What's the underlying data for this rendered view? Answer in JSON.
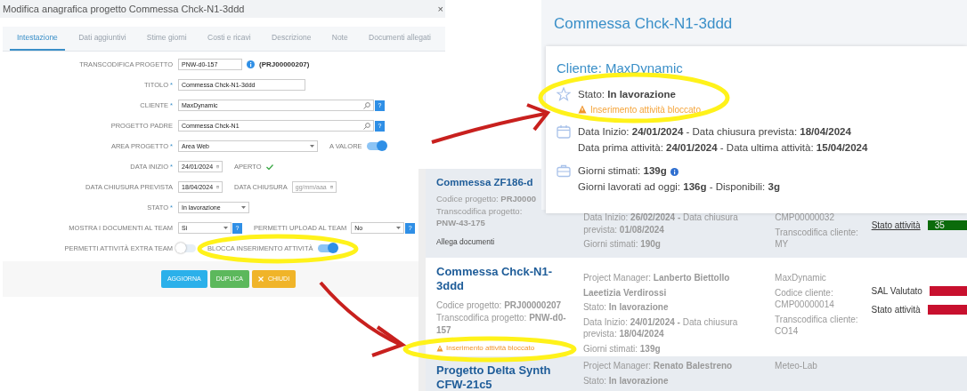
{
  "dialog": {
    "title": "Modifica anagrafica progetto Commessa Chck-N1-3ddd",
    "close": "×",
    "tabs": [
      {
        "label": "Intestazione",
        "selected": true
      },
      {
        "label": "Dati aggiuntivi",
        "selected": false
      },
      {
        "label": "Stime giorni",
        "selected": false
      },
      {
        "label": "Costi e ricavi",
        "selected": false
      },
      {
        "label": "Descrizione",
        "selected": false
      },
      {
        "label": "Note",
        "selected": false
      },
      {
        "label": "Documenti allegati",
        "selected": false
      }
    ],
    "rows": [
      {
        "label": "TRANSCODIFICA PROGETTO",
        "controls": [
          {
            "kind": "code",
            "value": "PNW-d0-157"
          },
          {
            "kind": "info"
          },
          {
            "kind": "note",
            "text": "(PRJ00000207)"
          }
        ]
      },
      {
        "label": "TITOLO",
        "marker": "*",
        "controls": [
          {
            "kind": "text",
            "value": "Commessa Chck-N1-3ddd"
          }
        ]
      },
      {
        "label": "CLIENTE",
        "marker": "*",
        "controls": [
          {
            "kind": "lookup",
            "value": "MaxDynamic"
          },
          {
            "kind": "help",
            "text": "?"
          }
        ]
      },
      {
        "label": "PROGETTO PADRE",
        "controls": [
          {
            "kind": "lookup",
            "value": "Commessa Chck-N1"
          },
          {
            "kind": "help",
            "text": "?"
          }
        ]
      },
      {
        "label": "AREA PROGETTO",
        "marker": "*",
        "controls": [
          {
            "kind": "combo",
            "value": "Area Web"
          },
          {
            "kind": "caption",
            "text": "A VALORE"
          },
          {
            "kind": "toggle",
            "on": true
          }
        ]
      },
      {
        "label": "DATA INIZIO",
        "marker": "*",
        "controls": [
          {
            "kind": "date",
            "value": "24/01/2024"
          },
          {
            "kind": "caption",
            "text": "APERTO"
          },
          {
            "kind": "check"
          }
        ]
      },
      {
        "label": "DATA CHIUSURA PREVISTA",
        "controls": [
          {
            "kind": "date",
            "value": "18/04/2024"
          },
          {
            "kind": "caption",
            "text": "DATA CHIUSURA"
          },
          {
            "kind": "date",
            "placeholder": "gg/mm/aaa"
          }
        ]
      },
      {
        "label": "STATO",
        "marker": "*",
        "controls": [
          {
            "kind": "select",
            "value": "In lavorazione"
          }
        ]
      },
      {
        "label": "MOSTRA I DOCUMENTI AL TEAM",
        "controls": [
          {
            "kind": "picker",
            "value": "Si"
          },
          {
            "kind": "help",
            "text": "?"
          },
          {
            "kind": "caption",
            "text": "PERMETTI UPLOAD AL TEAM"
          },
          {
            "kind": "picker",
            "value": "No"
          },
          {
            "kind": "help",
            "text": "?"
          }
        ]
      },
      {
        "label": "PERMETTI ATTIVITÀ EXTRA TEAM",
        "controls": [
          {
            "kind": "toggle",
            "on": false
          },
          {
            "kind": "caption",
            "text": "BLOCCA INSERIMENTO ATTIVITÀ"
          },
          {
            "kind": "toggle",
            "on": true
          }
        ]
      }
    ],
    "buttons": [
      {
        "label": "AGGIORNA"
      },
      {
        "label": "DUPLICA"
      },
      {
        "label": "CHIUDI",
        "close_icon": true
      }
    ]
  },
  "summary": {
    "title": "Commessa Chck-N1-3ddd",
    "client": "Cliente: MaxDynamic",
    "groups": [
      {
        "lines": [
          {
            "kind": "line",
            "text": "Stato: **In lavorazione**"
          },
          {
            "kind": "warning",
            "text": "Inserimento attività bloccato"
          }
        ]
      },
      {
        "lines": [
          {
            "kind": "line",
            "text": "Data Inizio: **24/01/2024** - Data chiusura prevista: **18/04/2024**"
          },
          {
            "kind": "line",
            "text": "Data prima attività: **24/01/2024** - Data ultima attività: **15/04/2024**"
          }
        ]
      },
      {
        "lines": [
          {
            "kind": "line",
            "text": "Giorni stimati: **139g**",
            "info": true
          },
          {
            "kind": "line",
            "text": "Giorni lavorati ad oggi: **136g** - Disponibili: **3g**"
          }
        ]
      }
    ]
  },
  "projects": [
    {
      "columns": [
        [
          {
            "kind": "title",
            "text": "Commessa ZF186-d"
          },
          {
            "kind": "line",
            "text": "Codice progetto: **PRJ0000**"
          },
          {
            "kind": "line",
            "text": "Transcodifica progetto: **PNW-43-175**"
          },
          {
            "kind": "plain",
            "text": "Allega documenti"
          }
        ],
        [
          {
            "kind": "line",
            "text": "Data Inizio: **26/02/2024 -** Data chiusura prevista: **01/08/2024**"
          },
          {
            "kind": "line",
            "text": "Giorni stimati: **190g**"
          }
        ],
        [
          {
            "kind": "line",
            "text": "CMP00000032"
          },
          {
            "kind": "line",
            "text": "Transcodifica cliente: MY"
          }
        ],
        [
          {
            "kind": "status",
            "text": "Stato attività",
            "link": true,
            "color": "#0b6b0b",
            "value": "35"
          }
        ]
      ]
    },
    {
      "columns": [
        [
          {
            "kind": "title",
            "text": "Commessa Chck-N1-3ddd"
          },
          {
            "kind": "line",
            "text": "Codice progetto: **PRJ00000207**"
          },
          {
            "kind": "line",
            "text": "Transcodifica progetto: **PNW-d0-157**"
          },
          {
            "kind": "warning",
            "text": "Inserimento attività bloccato"
          }
        ],
        [
          {
            "kind": "line",
            "text": "Project Manager: **Lanberto Biettollo**"
          },
          {
            "kind": "line",
            "text": "**Laeetizia Verdirossi**"
          },
          {
            "kind": "line",
            "text": "Stato: **In lavorazione**"
          },
          {
            "kind": "line",
            "text": "Data Inizio: **24/01/2024 -** Data chiusura prevista: **18/04/2024**"
          },
          {
            "kind": "line",
            "text": "Giorni stimati: **139g**"
          }
        ],
        [
          {
            "kind": "line",
            "text": "MaxDynamic"
          },
          {
            "kind": "line",
            "text": "Codice cliente: CMP00000014"
          },
          {
            "kind": "line",
            "text": "Transcodifica cliente: CO14"
          }
        ],
        [
          {
            "kind": "status",
            "text": "SAL Valutato",
            "link": false,
            "color": "#c8102e"
          },
          {
            "kind": "status",
            "text": "Stato attività",
            "link": false,
            "color": "#c8102e"
          }
        ]
      ]
    },
    {
      "columns": [
        [
          {
            "kind": "title",
            "text": "Progetto Delta Synth CFW-21c5"
          }
        ],
        [
          {
            "kind": "line",
            "text": "Project Manager: **Renato Balestreno**"
          },
          {
            "kind": "line",
            "text": "Stato: **In lavorazione**"
          }
        ],
        [
          {
            "kind": "line",
            "text": "Meteo-Lab"
          }
        ],
        []
      ]
    }
  ]
}
